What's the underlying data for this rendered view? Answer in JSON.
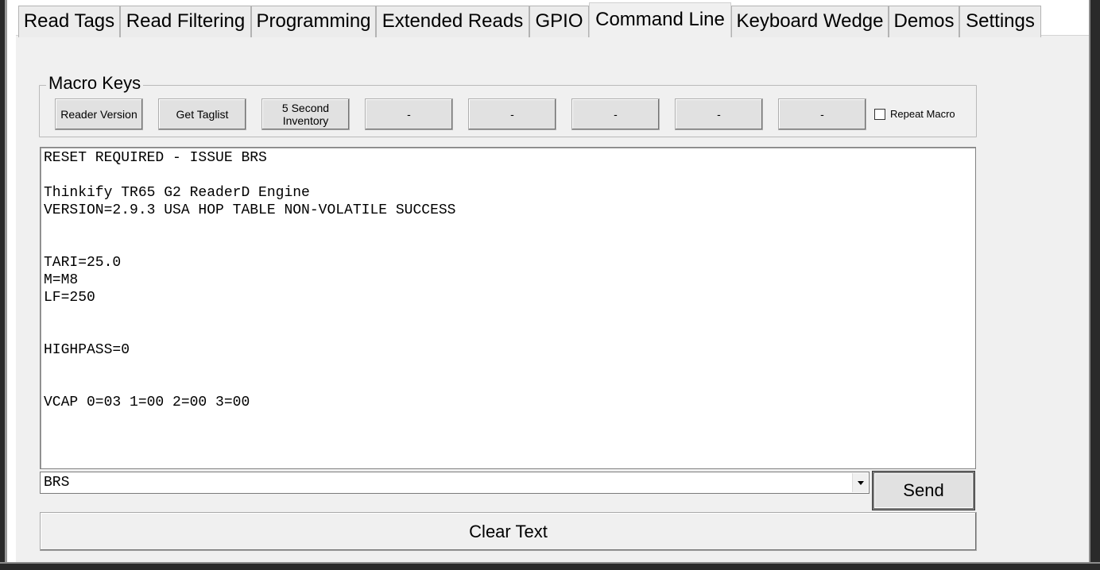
{
  "tabs": [
    {
      "label": "Read Tags",
      "active": false
    },
    {
      "label": "Read Filtering",
      "active": false
    },
    {
      "label": "Programming",
      "active": false
    },
    {
      "label": "Extended Reads",
      "active": false
    },
    {
      "label": "GPIO",
      "active": false
    },
    {
      "label": "Command Line",
      "active": true
    },
    {
      "label": "Keyboard Wedge",
      "active": false
    },
    {
      "label": "Demos",
      "active": false
    },
    {
      "label": "Settings",
      "active": false
    }
  ],
  "macro_keys": {
    "title": "Macro Keys",
    "buttons": [
      {
        "label": "Reader Version"
      },
      {
        "label": "Get Taglist"
      },
      {
        "label": "5 Second Inventory"
      },
      {
        "label": "-"
      },
      {
        "label": "-"
      },
      {
        "label": "-"
      },
      {
        "label": "-"
      },
      {
        "label": "-"
      }
    ],
    "repeat_label": "Repeat Macro",
    "repeat_checked": false
  },
  "output": {
    "text": "RESET REQUIRED - ISSUE BRS\n\nThinkify TR65 G2 ReaderD Engine\nVERSION=2.9.3 USA HOP TABLE NON-VOLATILE SUCCESS\n\n\nTARI=25.0\nM=M8\nLF=250\n\n\nHIGHPASS=0\n\n\nVCAP 0=03 1=00 2=00 3=00"
  },
  "command": {
    "value": "BRS",
    "send_label": "Send"
  },
  "clear_label": "Clear Text"
}
